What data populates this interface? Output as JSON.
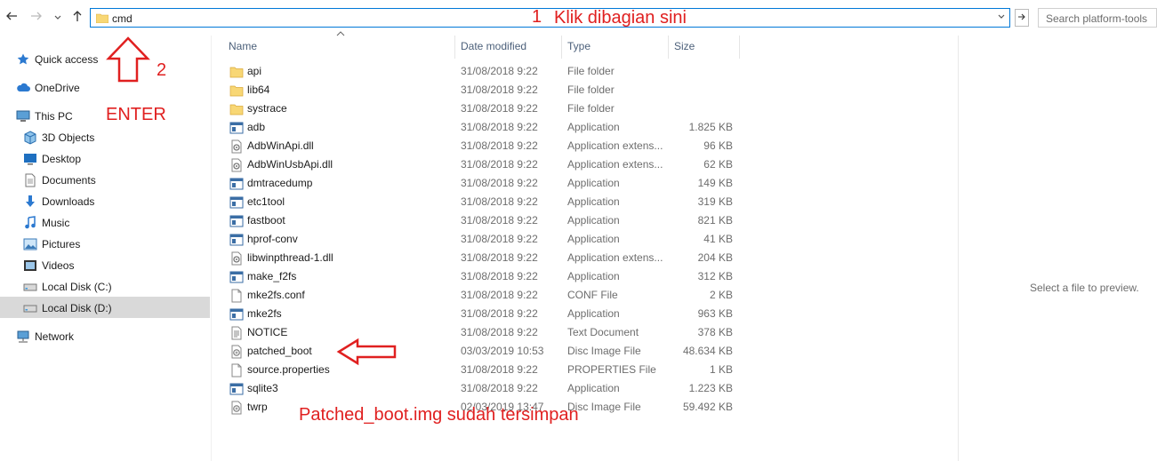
{
  "toolbar": {
    "back_icon": "back-arrow-icon",
    "forward_icon": "forward-arrow-icon",
    "history_icon": "chevron-down-icon",
    "up_icon": "up-arrow-icon"
  },
  "address_bar": {
    "value": "cmd"
  },
  "search": {
    "placeholder": "Search platform-tools"
  },
  "sidebar": {
    "items": [
      {
        "label": "Quick access",
        "icon": "star-icon"
      },
      {
        "label": "OneDrive",
        "icon": "cloud-icon"
      },
      {
        "label": "This PC",
        "icon": "computer-icon"
      },
      {
        "label": "3D Objects",
        "icon": "cube-icon"
      },
      {
        "label": "Desktop",
        "icon": "desktop-icon"
      },
      {
        "label": "Documents",
        "icon": "documents-icon"
      },
      {
        "label": "Downloads",
        "icon": "download-icon"
      },
      {
        "label": "Music",
        "icon": "music-icon"
      },
      {
        "label": "Pictures",
        "icon": "pictures-icon"
      },
      {
        "label": "Videos",
        "icon": "videos-icon"
      },
      {
        "label": "Local Disk (C:)",
        "icon": "drive-icon"
      },
      {
        "label": "Local Disk (D:)",
        "icon": "drive-icon"
      },
      {
        "label": "Network",
        "icon": "network-icon"
      }
    ],
    "selected": "Local Disk (D:)"
  },
  "columns": {
    "name": "Name",
    "date": "Date modified",
    "type": "Type",
    "size": "Size"
  },
  "files": [
    {
      "name": "api",
      "date": "31/08/2018 9:22",
      "type": "File folder",
      "size": "",
      "kind": "folder"
    },
    {
      "name": "lib64",
      "date": "31/08/2018 9:22",
      "type": "File folder",
      "size": "",
      "kind": "folder"
    },
    {
      "name": "systrace",
      "date": "31/08/2018 9:22",
      "type": "File folder",
      "size": "",
      "kind": "folder"
    },
    {
      "name": "adb",
      "date": "31/08/2018 9:22",
      "type": "Application",
      "size": "1.825 KB",
      "kind": "app"
    },
    {
      "name": "AdbWinApi.dll",
      "date": "31/08/2018 9:22",
      "type": "Application extens...",
      "size": "96 KB",
      "kind": "dll"
    },
    {
      "name": "AdbWinUsbApi.dll",
      "date": "31/08/2018 9:22",
      "type": "Application extens...",
      "size": "62 KB",
      "kind": "dll"
    },
    {
      "name": "dmtracedump",
      "date": "31/08/2018 9:22",
      "type": "Application",
      "size": "149 KB",
      "kind": "app"
    },
    {
      "name": "etc1tool",
      "date": "31/08/2018 9:22",
      "type": "Application",
      "size": "319 KB",
      "kind": "app"
    },
    {
      "name": "fastboot",
      "date": "31/08/2018 9:22",
      "type": "Application",
      "size": "821 KB",
      "kind": "app"
    },
    {
      "name": "hprof-conv",
      "date": "31/08/2018 9:22",
      "type": "Application",
      "size": "41 KB",
      "kind": "app"
    },
    {
      "name": "libwinpthread-1.dll",
      "date": "31/08/2018 9:22",
      "type": "Application extens...",
      "size": "204 KB",
      "kind": "dll"
    },
    {
      "name": "make_f2fs",
      "date": "31/08/2018 9:22",
      "type": "Application",
      "size": "312 KB",
      "kind": "app"
    },
    {
      "name": "mke2fs.conf",
      "date": "31/08/2018 9:22",
      "type": "CONF File",
      "size": "2 KB",
      "kind": "file"
    },
    {
      "name": "mke2fs",
      "date": "31/08/2018 9:22",
      "type": "Application",
      "size": "963 KB",
      "kind": "app"
    },
    {
      "name": "NOTICE",
      "date": "31/08/2018 9:22",
      "type": "Text Document",
      "size": "378 KB",
      "kind": "text"
    },
    {
      "name": "patched_boot",
      "date": "03/03/2019 10:53",
      "type": "Disc Image File",
      "size": "48.634 KB",
      "kind": "disc"
    },
    {
      "name": "source.properties",
      "date": "31/08/2018 9:22",
      "type": "PROPERTIES File",
      "size": "1 KB",
      "kind": "file"
    },
    {
      "name": "sqlite3",
      "date": "31/08/2018 9:22",
      "type": "Application",
      "size": "1.223 KB",
      "kind": "app"
    },
    {
      "name": "twrp",
      "date": "02/03/2019 13:47",
      "type": "Disc Image File",
      "size": "59.492 KB",
      "kind": "disc"
    }
  ],
  "preview": {
    "message": "Select a file to preview."
  },
  "annotations": {
    "step1_number": "1",
    "step1_text": "Klik dibagian sini",
    "step2_number": "2",
    "enter_text": "ENTER",
    "saved_text": "Patched_boot.img sudah tersimpan",
    "color": "#e02020"
  }
}
